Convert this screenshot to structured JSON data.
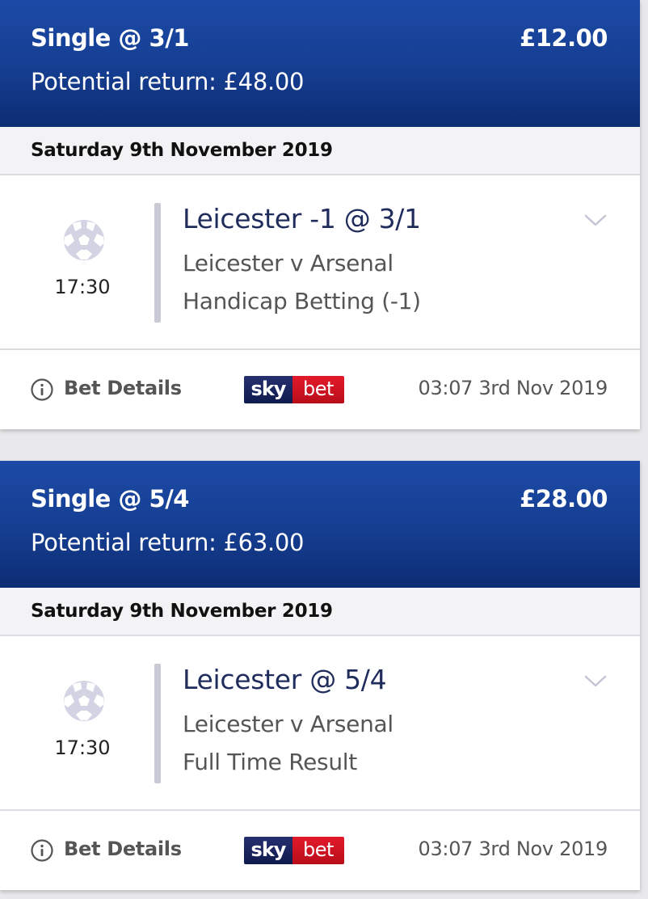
{
  "bets": [
    {
      "bet_type": "Single @ 3/1",
      "stake": "£12.00",
      "potential_return": "Potential return: £48.00",
      "date": "Saturday 9th November 2019",
      "time": "17:30",
      "sport_icon": "football-icon",
      "selection": "Leicester -1 @ 3/1",
      "event": "Leicester v Arsenal",
      "market": "Handicap Betting (-1)",
      "details_label": "Bet Details",
      "logo": {
        "sky": "sky",
        "bet": "bet"
      },
      "placed": "03:07 3rd Nov 2019"
    },
    {
      "bet_type": "Single @ 5/4",
      "stake": "£28.00",
      "potential_return": "Potential return: £63.00",
      "date": "Saturday 9th November 2019",
      "time": "17:30",
      "sport_icon": "football-icon",
      "selection": "Leicester @ 5/4",
      "event": "Leicester v Arsenal",
      "market": "Full Time Result",
      "details_label": "Bet Details",
      "logo": {
        "sky": "sky",
        "bet": "bet"
      },
      "placed": "03:07 3rd Nov 2019"
    }
  ],
  "colors": {
    "header_blue": "#163f93",
    "header_blue_dark": "#0d2d74",
    "selection_text": "#1f2c5c",
    "secondary_text": "#555555",
    "divider": "#c9cad6",
    "sky_navy": "#0f1a4d",
    "bet_red": "#e21a2a"
  }
}
